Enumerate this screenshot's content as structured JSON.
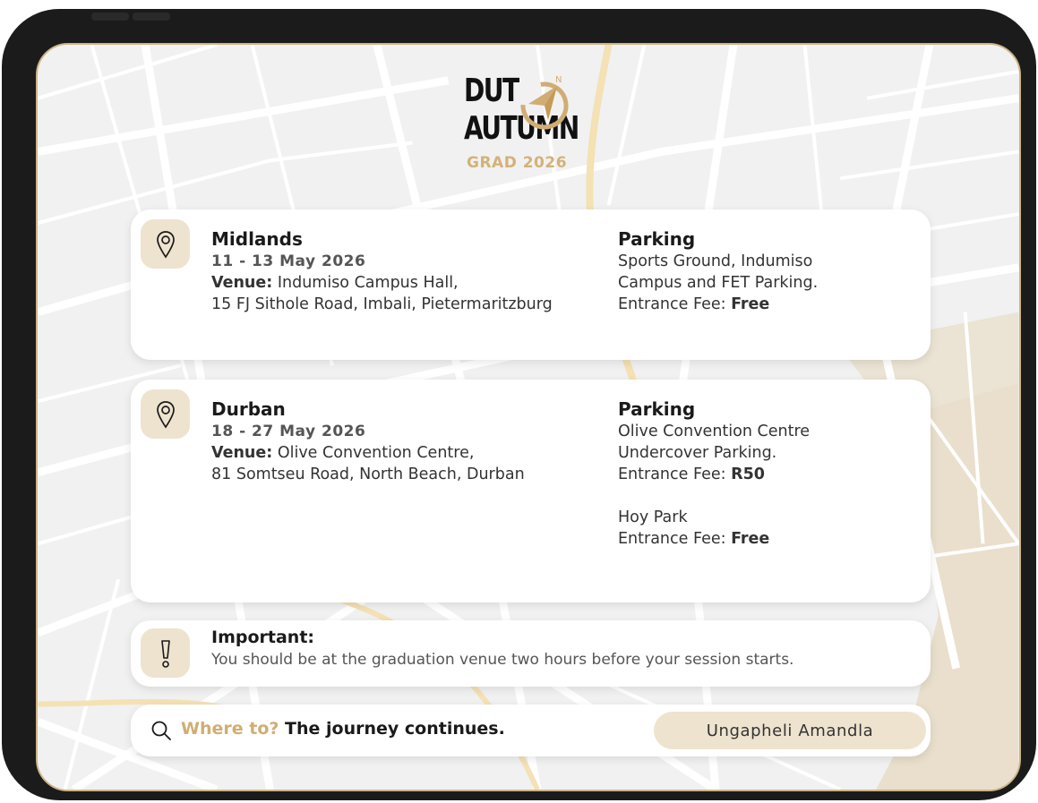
{
  "logo": {
    "line1": "DUT",
    "line2": "AUTUMN",
    "line3": "GRAD 2026"
  },
  "colors": {
    "accent": "#d1ad74",
    "pin_bg": "#eee3cf",
    "frame": "#1b1b1b",
    "map_bg": "#f1f1f1"
  },
  "midlands": {
    "icon": "location-pin-icon",
    "title": "Midlands",
    "dates": "11 - 13 May 2026",
    "venue_label": "Venue:",
    "venue_name": "Indumiso Campus Hall,",
    "venue_address": "15 FJ Sithole Road, Imbali, Pietermaritzburg",
    "parking_title": "Parking",
    "parking_line1": "Sports Ground, Indumiso",
    "parking_line2": "Campus and FET Parking.",
    "fee_label": "Entrance Fee:",
    "fee_value": "Free"
  },
  "durban": {
    "icon": "location-pin-icon",
    "title": "Durban",
    "dates": "18 - 27 May 2026",
    "venue_label": "Venue:",
    "venue_name": "Olive Convention Centre,",
    "venue_address": "81 Somtseu Road, North Beach, Durban",
    "parking_title": "Parking",
    "parking_line1": "Olive Convention Centre",
    "parking_line2": "Undercover Parking.",
    "fee_label": "Entrance Fee:",
    "fee_value": "R50",
    "parking2_line1": "Hoy Park",
    "fee2_label": "Entrance Fee:",
    "fee2_value": "Free"
  },
  "important": {
    "icon": "exclamation-icon",
    "title": "Important:",
    "text": "You should be at the graduation venue two hours before your session starts."
  },
  "search": {
    "icon": "search-icon",
    "accent_text": "Where to?",
    "text": "The journey continues.",
    "motto": "Ungapheli Amandla"
  }
}
